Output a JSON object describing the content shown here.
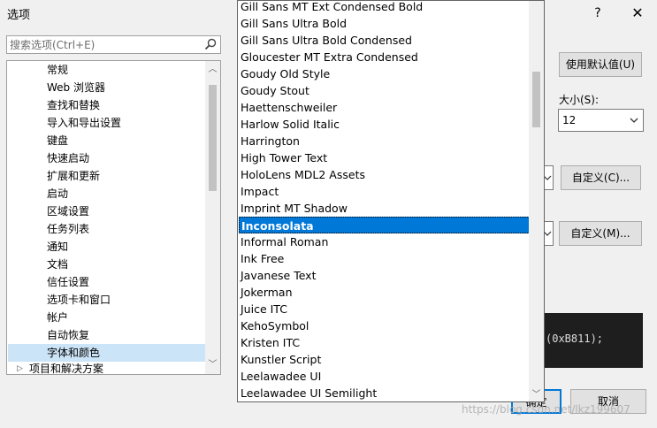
{
  "window": {
    "title": "选项",
    "help": "?",
    "close": "✕"
  },
  "search": {
    "placeholder": "搜索选项(Ctrl+E)"
  },
  "tree": {
    "items": [
      "常规",
      "Web 浏览器",
      "查找和替换",
      "导入和导出设置",
      "键盘",
      "快速启动",
      "扩展和更新",
      "启动",
      "区域设置",
      "任务列表",
      "通知",
      "文档",
      "信任设置",
      "选项卡和窗口",
      "帐户",
      "自动恢复",
      "字体和颜色"
    ],
    "selected": "字体和颜色",
    "next_root": "项目和解决方案"
  },
  "buttons": {
    "use_default": "使用默认值(U)",
    "custom_c": "自定义(C)...",
    "custom_m": "自定义(M)...",
    "ok": "确定",
    "cancel": "取消"
  },
  "size": {
    "label": "大小(S):",
    "value": "12"
  },
  "preview": {
    "text": "(0xB811);"
  },
  "font_list": {
    "items": [
      "Gill Sans MT Ext Condensed Bold",
      "Gill Sans Ultra Bold",
      "Gill Sans Ultra Bold Condensed",
      "Gloucester MT Extra Condensed",
      "Goudy Old Style",
      "Goudy Stout",
      "Haettenschweiler",
      "Harlow Solid Italic",
      "Harrington",
      "High Tower Text",
      "HoloLens MDL2 Assets",
      "Impact",
      "Imprint MT Shadow",
      "Inconsolata",
      "Informal Roman",
      "Ink Free",
      "Javanese Text",
      "Jokerman",
      "Juice ITC",
      "KehoSymbol",
      "Kristen ITC",
      "Kunstler Script",
      "Leelawadee UI",
      "Leelawadee UI Semilight"
    ],
    "selected": "Inconsolata"
  },
  "watermark": "https://blog.csdn.net/lkz199607",
  "colors": {
    "selection": "#0078d7",
    "tree_selection": "#cce4f7"
  }
}
